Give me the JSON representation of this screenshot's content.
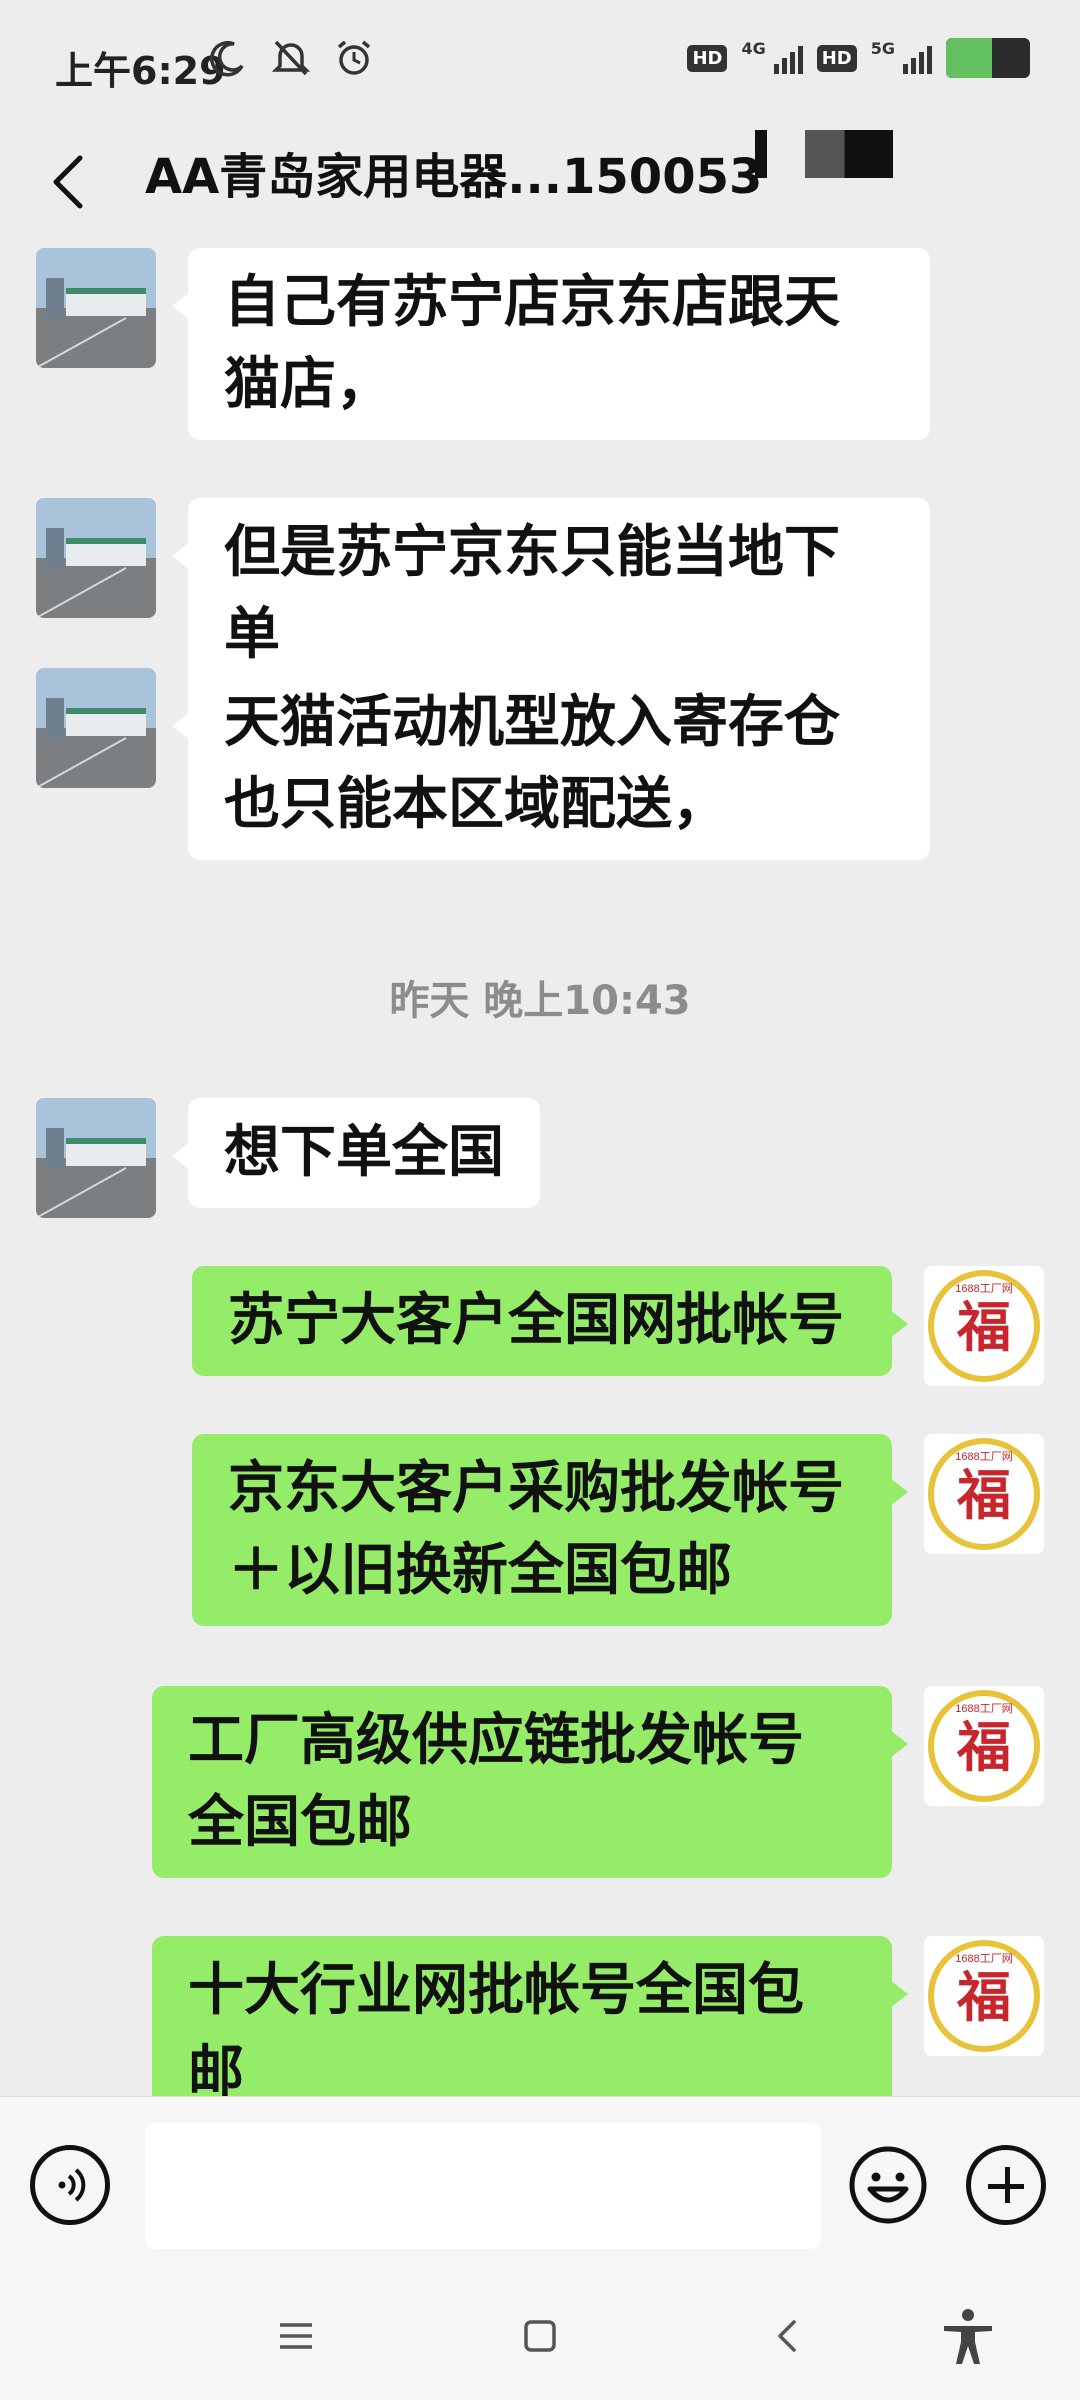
{
  "status_bar": {
    "time": "上午6:29",
    "network1": "4G",
    "network2": "5G",
    "hd1": "HD",
    "hd2": "HD",
    "battery_level": 0.55
  },
  "header": {
    "back_icon": "chevron-left-icon",
    "title": "AA青岛家用电器...150053"
  },
  "messages": [
    {
      "side": "in",
      "text": "自己有苏宁店京东店跟天猫店，"
    },
    {
      "side": "in",
      "text": "但是苏宁京东只能当地下单"
    },
    {
      "side": "in",
      "text": "天猫活动机型放入寄存仓也只能本区域配送，"
    },
    {
      "side": "in",
      "text": "想下单全国"
    },
    {
      "side": "out",
      "text": "苏宁大客户全国网批帐号"
    },
    {
      "side": "out",
      "text": "京东大客户采购批发帐号＋以旧换新全国包邮"
    },
    {
      "side": "out",
      "text": "工厂高级供应链批发帐号全国包邮"
    },
    {
      "side": "out",
      "text": "十大行业网批帐号全国包邮"
    }
  ],
  "timestamp": "昨天 晚上10:43",
  "avatar_logo_text": "1688工厂网",
  "avatar_logo_char": "福",
  "input_bar": {
    "voice_icon": "voice-icon",
    "emoji_icon": "emoji-icon",
    "plus_icon": "plus-icon",
    "text_value": ""
  },
  "nav": {
    "menu_icon": "menu-icon",
    "home_icon": "home-icon",
    "back_icon": "back-icon",
    "accessibility_icon": "accessibility-icon"
  },
  "colors": {
    "background": "#ededed",
    "incoming_bubble": "#ffffff",
    "outgoing_bubble": "#95ec69",
    "timestamp": "#8c8c8c"
  }
}
